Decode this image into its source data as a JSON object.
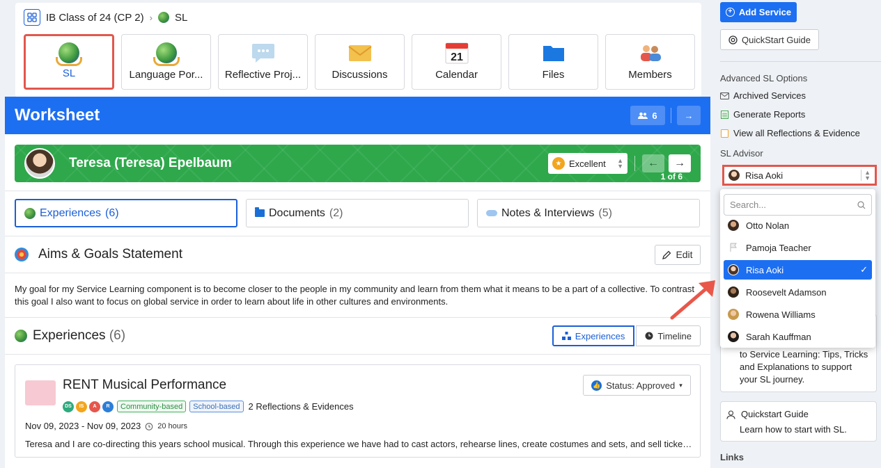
{
  "breadcrumb": {
    "class_name": "IB Class of 24 (CP 2)",
    "current": "SL"
  },
  "tiles": [
    {
      "label": "SL"
    },
    {
      "label": "Language Por..."
    },
    {
      "label": "Reflective Proj..."
    },
    {
      "label": "Discussions"
    },
    {
      "label": "Calendar",
      "day": "21"
    },
    {
      "label": "Files"
    },
    {
      "label": "Members"
    }
  ],
  "worksheet": {
    "title": "Worksheet",
    "member_count": "6",
    "student_name": "Teresa (Teresa) Epelbaum",
    "grade": "Excellent",
    "counter": "1 of 6",
    "tabs": [
      {
        "label": "Experiences",
        "count": "(6)"
      },
      {
        "label": "Documents",
        "count": "(2)"
      },
      {
        "label": "Notes & Interviews",
        "count": "(5)"
      }
    ],
    "aims_title": "Aims & Goals Statement",
    "edit_label": "Edit",
    "aims_text": "My goal for my Service Learning component is to become closer to the people in my community and learn from them what it means to be a part of a collective. To contrast this goal I also want to focus on global service in order to learn about life in other cultures and environments.",
    "experiences_title": "Experiences",
    "experiences_count": "(6)",
    "view_experiences": "Experiences",
    "view_timeline": "Timeline",
    "card": {
      "title": "RENT Musical Performance",
      "status": "Status: Approved",
      "initials": [
        "DS",
        "IS",
        "A",
        "R"
      ],
      "tag1": "Community-based",
      "tag2": "School-based",
      "reflections": "2 Reflections & Evidences",
      "dates": "Nov 09, 2023 - Nov 09, 2023",
      "hours": "20 hours",
      "description": "Teresa and I are co-directing this years school musical. Through this experience we have had to cast actors, rehearse lines, create costumes and sets, and sell tickets to the performance."
    }
  },
  "sidebar": {
    "add_service": "Add Service",
    "quickstart_btn": "QuickStart Guide",
    "advanced_label": "Advanced SL Options",
    "archived": "Archived Services",
    "reports": "Generate Reports",
    "view_all": "View all Reflections & Evidence",
    "advisor_label": "SL Advisor",
    "advisor_selected": "Risa Aoki",
    "search_placeholder": "Search...",
    "advisors": [
      "Otto Nolan",
      "Pamoja Teacher",
      "Risa Aoki",
      "Roosevelt Adamson",
      "Rowena Williams",
      "Sarah Kauffman"
    ],
    "guide_text": "to Service Learning: Tips, Tricks and Explanations to support your SL journey.",
    "quickstart_title": "Quickstart Guide",
    "quickstart_text": "Learn how to start with SL.",
    "links_label": "Links"
  }
}
